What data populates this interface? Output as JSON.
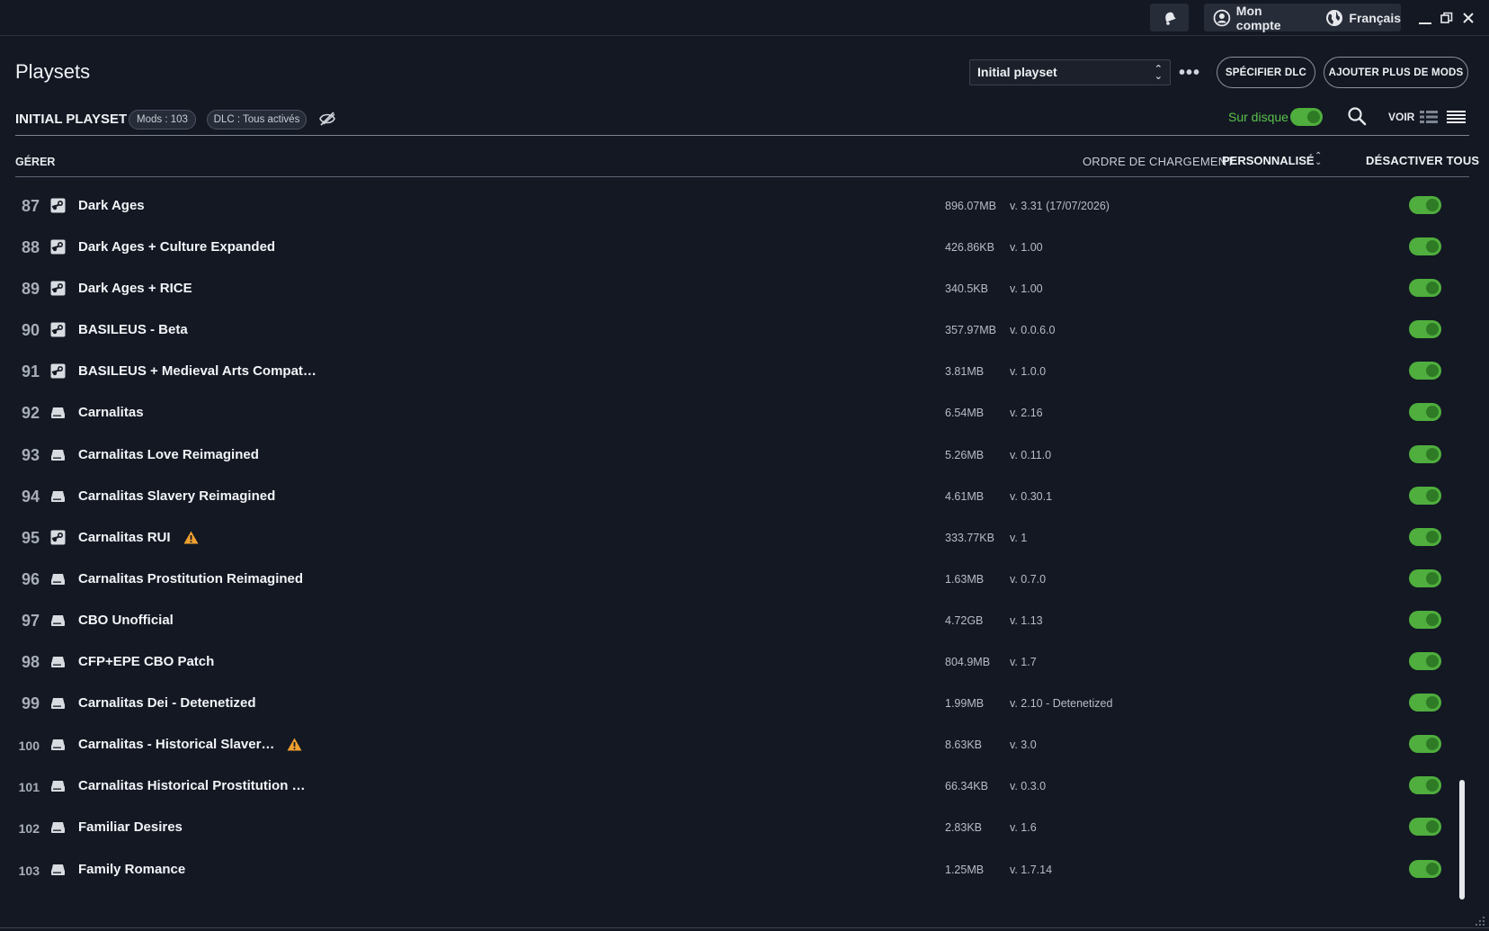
{
  "titlebar": {
    "account_label": "Mon compte",
    "language_label": "Français"
  },
  "header": {
    "title": "Playsets",
    "selected_playset": "Initial playset",
    "specify_dlc_label": "SPÉCIFIER DLC",
    "add_mods_label": "AJOUTER PLUS DE MODS"
  },
  "playset_bar": {
    "name": "INITIAL PLAYSET",
    "mods_chip": "Mods : 103",
    "dlc_chip": "DLC : Tous activés",
    "on_disk_label": "Sur disque",
    "view_label": "VOIR"
  },
  "manage_bar": {
    "manage_label": "GÉRER",
    "load_order_label": "ORDRE DE CHARGEMENT",
    "load_order_value": "PERSONNALISÉ",
    "disable_all_label": "DÉSACTIVER TOUS"
  },
  "colors": {
    "background": "#131823",
    "toggle_on": "#4fae3d",
    "warning": "#f0a030",
    "accent_green_text": "#5bc24a"
  },
  "mods": [
    {
      "num": "87",
      "source": "steam",
      "name": "Dark Ages",
      "warning": false,
      "size": "896.07MB",
      "version": "v. 3.31 (17/07/2026)",
      "enabled": true
    },
    {
      "num": "88",
      "source": "steam",
      "name": "Dark Ages + Culture Expanded",
      "warning": false,
      "size": "426.86KB",
      "version": "v. 1.00",
      "enabled": true
    },
    {
      "num": "89",
      "source": "steam",
      "name": "Dark Ages + RICE",
      "warning": false,
      "size": "340.5KB",
      "version": "v. 1.00",
      "enabled": true
    },
    {
      "num": "90",
      "source": "steam",
      "name": "BASILEUS - Beta",
      "warning": false,
      "size": "357.97MB",
      "version": "v. 0.0.6.0",
      "enabled": true
    },
    {
      "num": "91",
      "source": "steam",
      "name": "BASILEUS + Medieval Arts Compat…",
      "warning": false,
      "size": "3.81MB",
      "version": "v. 1.0.0",
      "enabled": true
    },
    {
      "num": "92",
      "source": "local",
      "name": "Carnalitas",
      "warning": false,
      "size": "6.54MB",
      "version": "v. 2.16",
      "enabled": true
    },
    {
      "num": "93",
      "source": "local",
      "name": "Carnalitas Love Reimagined",
      "warning": false,
      "size": "5.26MB",
      "version": "v. 0.11.0",
      "enabled": true
    },
    {
      "num": "94",
      "source": "local",
      "name": "Carnalitas Slavery Reimagined",
      "warning": false,
      "size": "4.61MB",
      "version": "v. 0.30.1",
      "enabled": true
    },
    {
      "num": "95",
      "source": "steam",
      "name": "Carnalitas RUI",
      "warning": true,
      "size": "333.77KB",
      "version": "v. 1",
      "enabled": true
    },
    {
      "num": "96",
      "source": "local",
      "name": "Carnalitas Prostitution Reimagined",
      "warning": false,
      "size": "1.63MB",
      "version": "v. 0.7.0",
      "enabled": true
    },
    {
      "num": "97",
      "source": "local",
      "name": "CBO Unofficial",
      "warning": false,
      "size": "4.72GB",
      "version": "v. 1.13",
      "enabled": true
    },
    {
      "num": "98",
      "source": "local",
      "name": "CFP+EPE CBO Patch",
      "warning": false,
      "size": "804.9MB",
      "version": "v. 1.7",
      "enabled": true
    },
    {
      "num": "99",
      "source": "local",
      "name": "Carnalitas Dei - Detenetized",
      "warning": false,
      "size": "1.99MB",
      "version": "v. 2.10 - Detenetized",
      "enabled": true
    },
    {
      "num": "100",
      "source": "local",
      "name": "Carnalitas - Historical Slaver…",
      "warning": true,
      "size": "8.63KB",
      "version": "v. 3.0",
      "enabled": true
    },
    {
      "num": "101",
      "source": "local",
      "name": "Carnalitas Historical Prostitution …",
      "warning": false,
      "size": "66.34KB",
      "version": "v. 0.3.0",
      "enabled": true
    },
    {
      "num": "102",
      "source": "local",
      "name": "Familiar Desires",
      "warning": false,
      "size": "2.83KB",
      "version": "v. 1.6",
      "enabled": true
    },
    {
      "num": "103",
      "source": "local",
      "name": "Family Romance",
      "warning": false,
      "size": "1.25MB",
      "version": "v. 1.7.14",
      "enabled": true
    }
  ]
}
